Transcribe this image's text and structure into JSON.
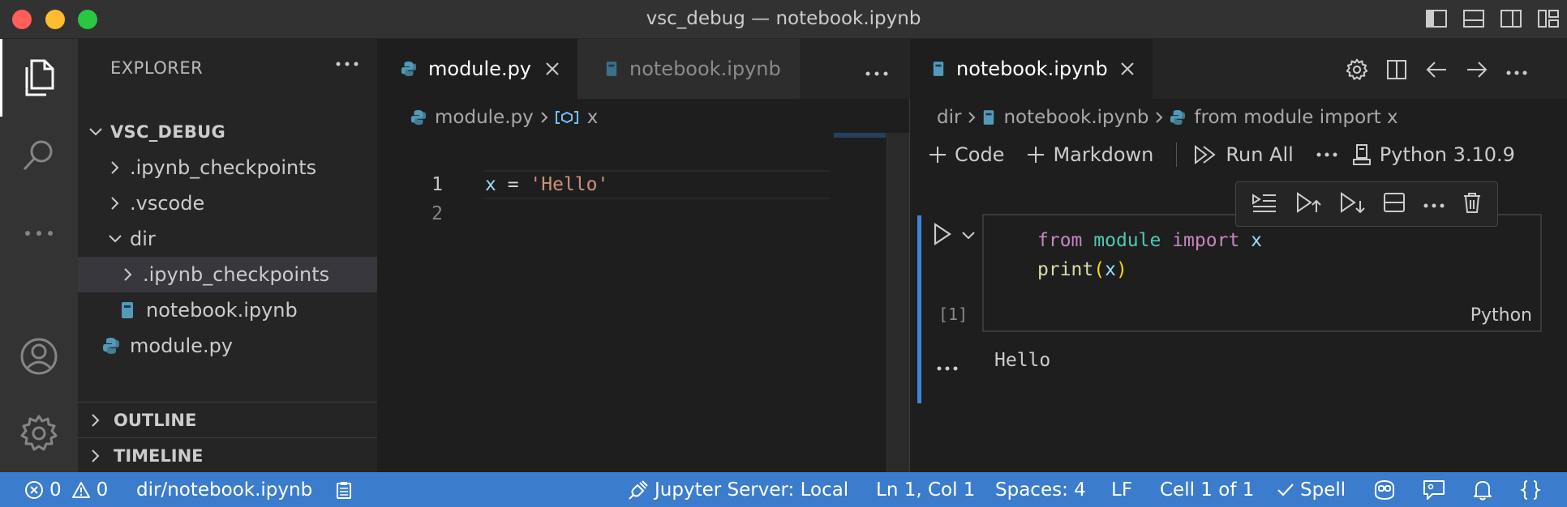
{
  "window": {
    "title": "vsc_debug — notebook.ipynb"
  },
  "colors": {
    "accent": "#3c7ccc",
    "cell_bar": "#3d87d8",
    "python_icon": "#519aba",
    "notebook_icon": "#519aba"
  },
  "activity_bar": {
    "items": [
      "explorer-icon",
      "search-icon",
      "more-icon",
      "account-icon",
      "settings-gear-icon"
    ]
  },
  "sidebar": {
    "header": "EXPLORER",
    "root": "VSC_DEBUG",
    "tree": [
      {
        "label": ".ipynb_checkpoints",
        "type": "folder",
        "expanded": false
      },
      {
        "label": ".vscode",
        "type": "folder",
        "expanded": false
      },
      {
        "label": "dir",
        "type": "folder",
        "expanded": true
      },
      {
        "label": ".ipynb_checkpoints",
        "type": "folder",
        "expanded": false
      },
      {
        "label": "notebook.ipynb",
        "type": "notebook"
      },
      {
        "label": "module.py",
        "type": "python"
      }
    ],
    "sections": [
      "OUTLINE",
      "TIMELINE"
    ]
  },
  "left_editor": {
    "tabs": [
      {
        "label": "module.py",
        "icon": "python-file-icon"
      },
      {
        "label": "notebook.ipynb",
        "icon": "notebook-file-icon"
      }
    ],
    "breadcrumb": {
      "file": "module.py",
      "symbol": "x"
    },
    "lines": [
      {
        "num": "1",
        "var": "x",
        "op": " = ",
        "str": "'Hello'"
      },
      {
        "num": "2"
      }
    ]
  },
  "right_editor": {
    "tab": "notebook.ipynb",
    "breadcrumb": {
      "dir": "dir",
      "file": "notebook.ipynb",
      "cell": "from module import x"
    },
    "toolbar": {
      "code": "Code",
      "markdown": "Markdown",
      "run_all": "Run All",
      "kernel": "Python 3.10.9"
    },
    "cell": {
      "line1": {
        "kw1": "from",
        "mod": "module",
        "kw2": "import",
        "var": "x"
      },
      "line2": {
        "fn": "print",
        "open": "(",
        "arg": "x",
        "close": ")"
      },
      "exec_count": "[1]",
      "language": "Python",
      "output": "Hello"
    }
  },
  "status_bar": {
    "errors": "0",
    "warnings": "0",
    "path": "dir/notebook.ipynb",
    "jupyter": "Jupyter Server: Local",
    "position": "Ln 1, Col 1",
    "spaces": "Spaces: 4",
    "eol": "LF",
    "cell": "Cell 1 of 1",
    "spell": "Spell"
  }
}
